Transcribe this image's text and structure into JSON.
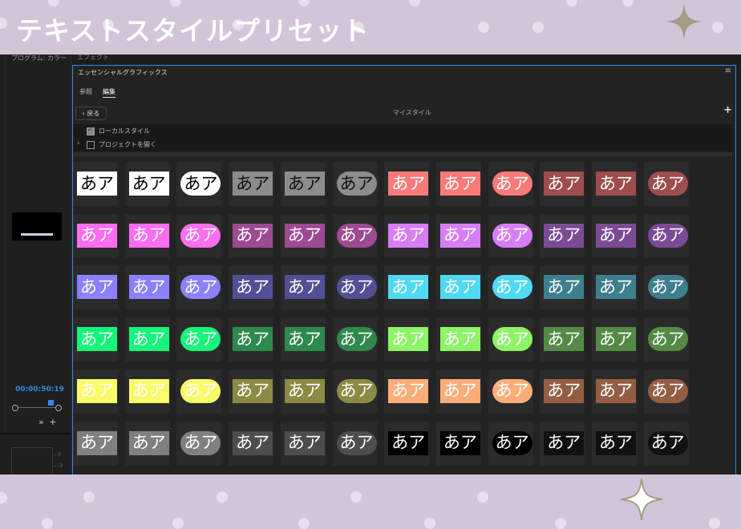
{
  "banner": {
    "title": "テキストスタイルプリセット"
  },
  "left_panel": {
    "tab_label": "プログラム: カラー",
    "timecode": "00:00:50:19",
    "meter_labels": [
      "- 0",
      "- -3"
    ]
  },
  "effects_tab": "エフェクト",
  "panel": {
    "title": "エッセンシャルグラフィックス",
    "menu_icon": "≡",
    "tabs": [
      {
        "label": "参照",
        "active": false
      },
      {
        "label": "編集",
        "active": true
      }
    ],
    "back_label": "戻る",
    "my_styles_label": "マイスタイル",
    "add_label": "+",
    "local_styles": {
      "label": "ローカルスタイル",
      "checked": true
    },
    "open_project": {
      "label": "プロジェクトを開く",
      "checked": false
    }
  },
  "presets": {
    "sample_text": "あア",
    "rows": [
      [
        {
          "bg": "#ffffff",
          "fg": "#000000",
          "shape": "rect"
        },
        {
          "bg": "#ffffff",
          "fg": "#000000",
          "shape": "rect"
        },
        {
          "bg": "#ffffff",
          "fg": "#000000",
          "shape": "pill"
        },
        {
          "bg": "#8c8c8c",
          "fg": "#111111",
          "shape": "rect"
        },
        {
          "bg": "#8c8c8c",
          "fg": "#111111",
          "shape": "rect"
        },
        {
          "bg": "#8c8c8c",
          "fg": "#111111",
          "shape": "pill"
        },
        {
          "bg": "#fa7a78",
          "fg": "#ffffff",
          "shape": "rect"
        },
        {
          "bg": "#fa7a78",
          "fg": "#ffffff",
          "shape": "rect"
        },
        {
          "bg": "#fa7a78",
          "fg": "#ffffff",
          "shape": "pill"
        },
        {
          "bg": "#9e4c4d",
          "fg": "#ffffff",
          "shape": "rect"
        },
        {
          "bg": "#9e4c4d",
          "fg": "#ffffff",
          "shape": "rect"
        },
        {
          "bg": "#9e4c4d",
          "fg": "#ffffff",
          "shape": "pill"
        }
      ],
      [
        {
          "bg": "#ff6ef2",
          "fg": "#ffffff",
          "shape": "rect"
        },
        {
          "bg": "#ff6ef2",
          "fg": "#ffffff",
          "shape": "rect"
        },
        {
          "bg": "#ff6ef2",
          "fg": "#ffffff",
          "shape": "pill"
        },
        {
          "bg": "#9e4a92",
          "fg": "#ffffff",
          "shape": "rect"
        },
        {
          "bg": "#9e4a92",
          "fg": "#ffffff",
          "shape": "rect"
        },
        {
          "bg": "#9e4a92",
          "fg": "#ffffff",
          "shape": "pill"
        },
        {
          "bg": "#d77ef6",
          "fg": "#ffffff",
          "shape": "rect"
        },
        {
          "bg": "#d77ef6",
          "fg": "#ffffff",
          "shape": "rect"
        },
        {
          "bg": "#d77ef6",
          "fg": "#ffffff",
          "shape": "pill"
        },
        {
          "bg": "#7c4b96",
          "fg": "#ffffff",
          "shape": "rect"
        },
        {
          "bg": "#7c4b96",
          "fg": "#ffffff",
          "shape": "rect"
        },
        {
          "bg": "#7c4b96",
          "fg": "#ffffff",
          "shape": "pill"
        }
      ],
      [
        {
          "bg": "#8b80ff",
          "fg": "#ffffff",
          "shape": "rect"
        },
        {
          "bg": "#8b80ff",
          "fg": "#ffffff",
          "shape": "rect"
        },
        {
          "bg": "#8b80ff",
          "fg": "#ffffff",
          "shape": "pill"
        },
        {
          "bg": "#534f96",
          "fg": "#ffffff",
          "shape": "rect"
        },
        {
          "bg": "#534f96",
          "fg": "#ffffff",
          "shape": "rect"
        },
        {
          "bg": "#534f96",
          "fg": "#ffffff",
          "shape": "pill"
        },
        {
          "bg": "#4fd9f4",
          "fg": "#ffffff",
          "shape": "rect"
        },
        {
          "bg": "#4fd9f4",
          "fg": "#ffffff",
          "shape": "rect"
        },
        {
          "bg": "#4fd9f4",
          "fg": "#ffffff",
          "shape": "pill"
        },
        {
          "bg": "#3e7f8d",
          "fg": "#ffffff",
          "shape": "rect"
        },
        {
          "bg": "#3e7f8d",
          "fg": "#ffffff",
          "shape": "rect"
        },
        {
          "bg": "#3e7f8d",
          "fg": "#ffffff",
          "shape": "pill"
        }
      ],
      [
        {
          "bg": "#16f57a",
          "fg": "#ffffff",
          "shape": "rect"
        },
        {
          "bg": "#16f57a",
          "fg": "#ffffff",
          "shape": "rect"
        },
        {
          "bg": "#16f57a",
          "fg": "#ffffff",
          "shape": "pill"
        },
        {
          "bg": "#2e8a4c",
          "fg": "#ffffff",
          "shape": "rect"
        },
        {
          "bg": "#2e8a4c",
          "fg": "#ffffff",
          "shape": "rect"
        },
        {
          "bg": "#2e8a4c",
          "fg": "#ffffff",
          "shape": "pill"
        },
        {
          "bg": "#8df467",
          "fg": "#ffffff",
          "shape": "rect"
        },
        {
          "bg": "#8df467",
          "fg": "#ffffff",
          "shape": "rect"
        },
        {
          "bg": "#8df467",
          "fg": "#ffffff",
          "shape": "pill"
        },
        {
          "bg": "#558a46",
          "fg": "#ffffff",
          "shape": "rect"
        },
        {
          "bg": "#558a46",
          "fg": "#ffffff",
          "shape": "rect"
        },
        {
          "bg": "#558a46",
          "fg": "#ffffff",
          "shape": "pill"
        }
      ],
      [
        {
          "bg": "#fafb6a",
          "fg": "#ffffff",
          "shape": "rect"
        },
        {
          "bg": "#fafb6a",
          "fg": "#ffffff",
          "shape": "rect"
        },
        {
          "bg": "#fafb6a",
          "fg": "#ffffff",
          "shape": "pill"
        },
        {
          "bg": "#8c8a44",
          "fg": "#ffffff",
          "shape": "rect"
        },
        {
          "bg": "#8c8a44",
          "fg": "#ffffff",
          "shape": "rect"
        },
        {
          "bg": "#8c8a44",
          "fg": "#ffffff",
          "shape": "pill"
        },
        {
          "bg": "#fdad78",
          "fg": "#ffffff",
          "shape": "rect"
        },
        {
          "bg": "#fdad78",
          "fg": "#ffffff",
          "shape": "rect"
        },
        {
          "bg": "#fdad78",
          "fg": "#ffffff",
          "shape": "pill"
        },
        {
          "bg": "#935e44",
          "fg": "#ffffff",
          "shape": "rect"
        },
        {
          "bg": "#935e44",
          "fg": "#ffffff",
          "shape": "rect"
        },
        {
          "bg": "#935e44",
          "fg": "#ffffff",
          "shape": "pill"
        }
      ],
      [
        {
          "bg": "#808080",
          "fg": "#ffffff",
          "shape": "rect"
        },
        {
          "bg": "#808080",
          "fg": "#ffffff",
          "shape": "rect"
        },
        {
          "bg": "#808080",
          "fg": "#ffffff",
          "shape": "pill"
        },
        {
          "bg": "#4d4d4d",
          "fg": "#ffffff",
          "shape": "rect"
        },
        {
          "bg": "#4d4d4d",
          "fg": "#ffffff",
          "shape": "rect"
        },
        {
          "bg": "#4d4d4d",
          "fg": "#ffffff",
          "shape": "pill"
        },
        {
          "bg": "#000000",
          "fg": "#ffffff",
          "shape": "rect"
        },
        {
          "bg": "#000000",
          "fg": "#ffffff",
          "shape": "rect"
        },
        {
          "bg": "#000000",
          "fg": "#ffffff",
          "shape": "pill"
        },
        {
          "bg": "#111111",
          "fg": "#ffffff",
          "shape": "rect"
        },
        {
          "bg": "#111111",
          "fg": "#ffffff",
          "shape": "rect"
        },
        {
          "bg": "#111111",
          "fg": "#ffffff",
          "shape": "pill"
        }
      ]
    ]
  }
}
